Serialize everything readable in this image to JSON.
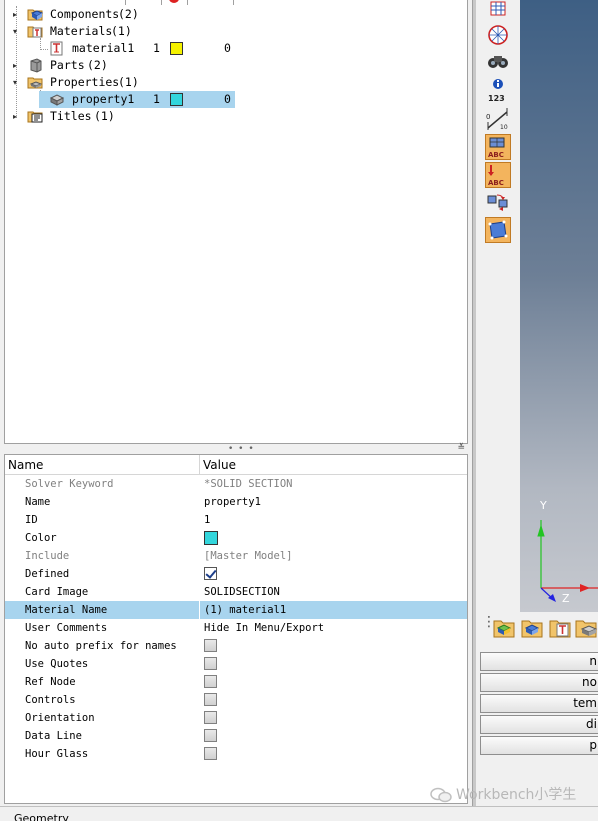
{
  "tree": {
    "items": [
      {
        "label": "Components",
        "count": "(2)",
        "icon": "components-folder-icon"
      },
      {
        "label": "Materials",
        "count": "(1)",
        "icon": "materials-folder-icon"
      },
      {
        "label": "material1",
        "id": "1",
        "value": "0",
        "color": "#f5f200",
        "icon": "material-icon"
      },
      {
        "label": "Parts",
        "count": "(2)",
        "icon": "parts-folder-icon"
      },
      {
        "label": "Properties",
        "count": "(1)",
        "icon": "properties-folder-icon"
      },
      {
        "label": "property1",
        "id": "1",
        "value": "0",
        "color": "#33d6dc",
        "icon": "property-icon"
      },
      {
        "label": "Titles",
        "count": "(1)",
        "icon": "titles-folder-icon"
      }
    ]
  },
  "properties": {
    "header": {
      "name": "Name",
      "value": "Value"
    },
    "rows": [
      {
        "name": "Solver Keyword",
        "value": "*SOLID SECTION"
      },
      {
        "name": "Name",
        "value": "property1"
      },
      {
        "name": "ID",
        "value": "1"
      },
      {
        "name": "Color",
        "value": "",
        "swatch_color": "#33d6dc"
      },
      {
        "name": "Include",
        "value": "[Master Model]"
      },
      {
        "name": "Defined",
        "checked": true
      },
      {
        "name": "Card Image",
        "value": "SOLIDSECTION"
      },
      {
        "name": "Material Name",
        "value": "(1) material1"
      },
      {
        "name": "User Comments",
        "value": "Hide In Menu/Export"
      },
      {
        "name": "No auto prefix for names",
        "checked": false
      },
      {
        "name": "Use Quotes",
        "checked": false
      },
      {
        "name": "Ref Node",
        "checked": false
      },
      {
        "name": "Controls",
        "checked": false
      },
      {
        "name": "Orientation",
        "checked": false
      },
      {
        "name": "Data Line",
        "checked": false
      },
      {
        "name": "Hour Glass",
        "checked": false
      }
    ]
  },
  "toolbar": {
    "numbering_label": "123"
  },
  "viewport": {
    "axis_y": "Y",
    "axis_z": "Z"
  },
  "panel_buttons": [
    "n",
    "no",
    "tem",
    "di",
    "p"
  ],
  "status": {
    "text": "Geometry"
  },
  "watermark": {
    "text": "Workbench小学生"
  },
  "colors": {
    "selection": "#a8d4ee",
    "accent_orange": "#f3b45d",
    "viewport_top": "#3e5f84"
  }
}
